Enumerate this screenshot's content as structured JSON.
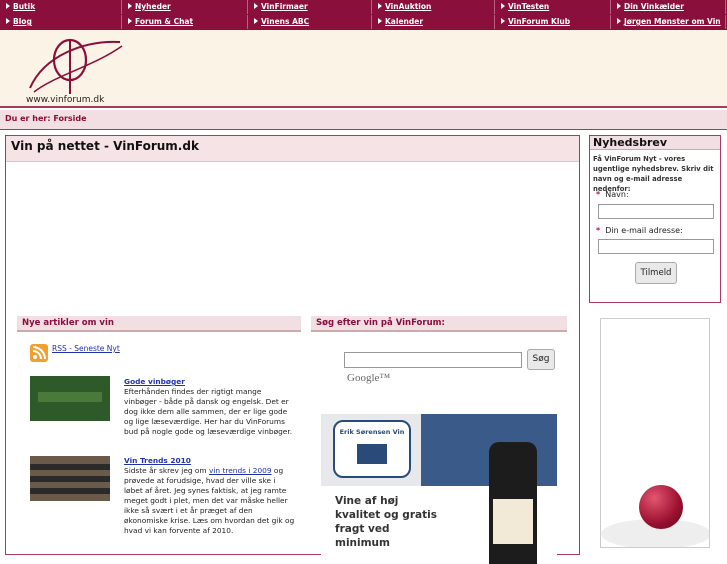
{
  "nav": {
    "row1": [
      "Butik",
      "Nyheder",
      "VinFirmaer",
      "VinAuktion",
      "VinTesten",
      "Din Vinkælder"
    ],
    "row2": [
      "Blog",
      "Forum & Chat",
      "Vinens ABC",
      "Kalender",
      "VinForum Klub",
      "Jørgen Mønster om Vin"
    ]
  },
  "header": {
    "logo_text": "www.vinforum.dk"
  },
  "breadcrumb": "Du er her: Forside",
  "main": {
    "title": "Vin på nettet - VinForum.dk"
  },
  "articles": {
    "heading": "Nye artikler om vin",
    "rss_label": "RSS - Seneste Nyt",
    "items": [
      {
        "title": "Gode vinbøger",
        "body": "Efterhånden findes der rigtigt mange vinbøger - både på dansk og engelsk. Det er dog ikke dem alle sammen, der er lige gode og lige læseværdige. Her har du VinForums bud på nogle gode og læseværdige vinbøger."
      },
      {
        "title": "Vin Trends 2010",
        "body_pre": "Sidste år skrev jeg om ",
        "body_link": "vin trends i 2009",
        "body_post": " og prøvede at forudsige, hvad der ville ske i løbet af året. Jeg synes faktisk, at jeg ramte meget godt i plet, men det var måske heller ikke så svært i et år præget af den økonomiske krise. Læs om hvordan det gik og hvad vi kan forvente af 2010."
      }
    ]
  },
  "search": {
    "heading": "Søg efter vin på VinForum:",
    "button": "Søg",
    "powered": "Google™"
  },
  "ad": {
    "brand": "Erik Sørensen Vin",
    "text": "Vine af høj kvalitet og gratis fragt ved minimum"
  },
  "newsletter": {
    "heading": "Nyhedsbrev",
    "desc": "Få VinForum Nyt - vores ugentlige nyhedsbrev. Skriv dit navn og e-mail adresse nedenfor:",
    "name_label": "Navn:",
    "email_label": "Din e-mail adresse:",
    "required": "*",
    "button": "Tilmeld"
  },
  "colors": {
    "brand": "#8a0f3a",
    "cream": "#fbf3e5",
    "pink": "#f2dfe4",
    "link": "#2233aa"
  }
}
